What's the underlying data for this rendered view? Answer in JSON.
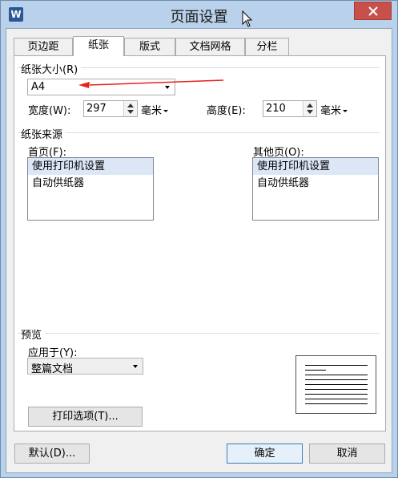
{
  "window": {
    "title": "页面设置"
  },
  "tabs": [
    "页边距",
    "纸张",
    "版式",
    "文档网格",
    "分栏"
  ],
  "active_tab": "纸张",
  "paper_size": {
    "group_label": "纸张大小(R)",
    "selected": "A4",
    "width_label": "宽度(W):",
    "width_value": "297",
    "width_unit": "毫米",
    "height_label": "高度(E):",
    "height_value": "210",
    "height_unit": "毫米"
  },
  "paper_source": {
    "group_label": "纸张来源",
    "first_page_label": "首页(F):",
    "first_page_options": [
      "使用打印机设置",
      "自动供纸器"
    ],
    "other_pages_label": "其他页(O):",
    "other_pages_options": [
      "使用打印机设置",
      "自动供纸器"
    ]
  },
  "preview": {
    "group_label": "预览",
    "apply_to_label": "应用于(Y):",
    "apply_to_value": "整篇文档",
    "print_options_button": "打印选项(T)..."
  },
  "buttons": {
    "default": "默认(D)...",
    "ok": "确定",
    "cancel": "取消"
  },
  "colors": {
    "accent_arrow": "#e8221c",
    "title_bar": "#b9d1ea",
    "close_button": "#c7504b",
    "selection": "#dbe7f7"
  }
}
